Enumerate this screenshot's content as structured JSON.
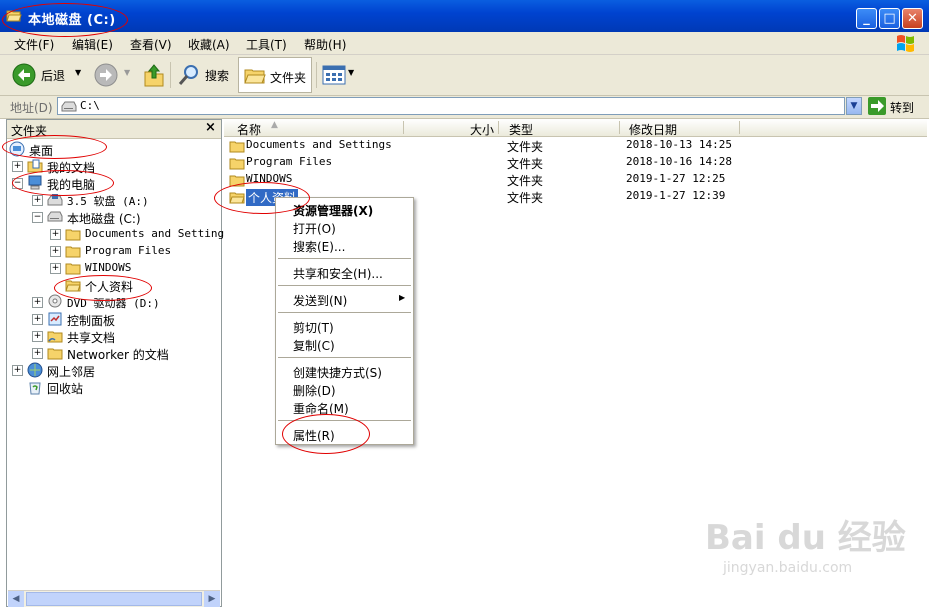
{
  "window": {
    "title": "本地磁盘 (C:)",
    "minimize_label": "_",
    "maximize_label": "□",
    "close_label": "✕"
  },
  "menubar": {
    "items": [
      "文件(F)",
      "编辑(E)",
      "查看(V)",
      "收藏(A)",
      "工具(T)",
      "帮助(H)"
    ]
  },
  "toolbar": {
    "back_label": "后退",
    "search_label": "搜索",
    "folders_label": "文件夹"
  },
  "address": {
    "label": "地址(D)",
    "value": "C:\\",
    "go_label": "转到"
  },
  "folder_pane": {
    "title": "文件夹",
    "close_label": "×",
    "tree": [
      {
        "label": "桌面"
      },
      {
        "label": "我的文档"
      },
      {
        "label": "我的电脑"
      },
      {
        "label": "3.5 软盘 (A:)"
      },
      {
        "label": "本地磁盘 (C:)"
      },
      {
        "label": "Documents and Settings"
      },
      {
        "label": "Program Files"
      },
      {
        "label": "WINDOWS"
      },
      {
        "label": "个人资料"
      },
      {
        "label": "DVD 驱动器 (D:)"
      },
      {
        "label": "控制面板"
      },
      {
        "label": "共享文档"
      },
      {
        "label": "Networker 的文档"
      },
      {
        "label": "网上邻居"
      },
      {
        "label": "回收站"
      }
    ]
  },
  "file_pane": {
    "columns": [
      "名称",
      "大小",
      "类型",
      "修改日期"
    ],
    "rows": [
      {
        "name": "Documents and Settings",
        "type": "文件夹",
        "date": "2018-10-13 14:25"
      },
      {
        "name": "Program Files",
        "type": "文件夹",
        "date": "2018-10-16 14:28"
      },
      {
        "name": "WINDOWS",
        "type": "文件夹",
        "date": "2019-1-27 12:25"
      },
      {
        "name": "个人资料",
        "type": "文件夹",
        "date": "2019-1-27 12:39"
      }
    ]
  },
  "context_menu": {
    "items": [
      "资源管理器(X)",
      "打开(O)",
      "搜索(E)...",
      "共享和安全(H)...",
      "发送到(N)",
      "剪切(T)",
      "复制(C)",
      "创建快捷方式(S)",
      "删除(D)",
      "重命名(M)",
      "属性(R)"
    ],
    "submenu_arrow": "▶"
  },
  "watermark": {
    "main": "Bai du 经验",
    "sub": "jingyan.baidu.com"
  },
  "colors": {
    "titlebar": "#0a5ee0",
    "selection": "#316ac5",
    "annotation": "#e00000"
  }
}
